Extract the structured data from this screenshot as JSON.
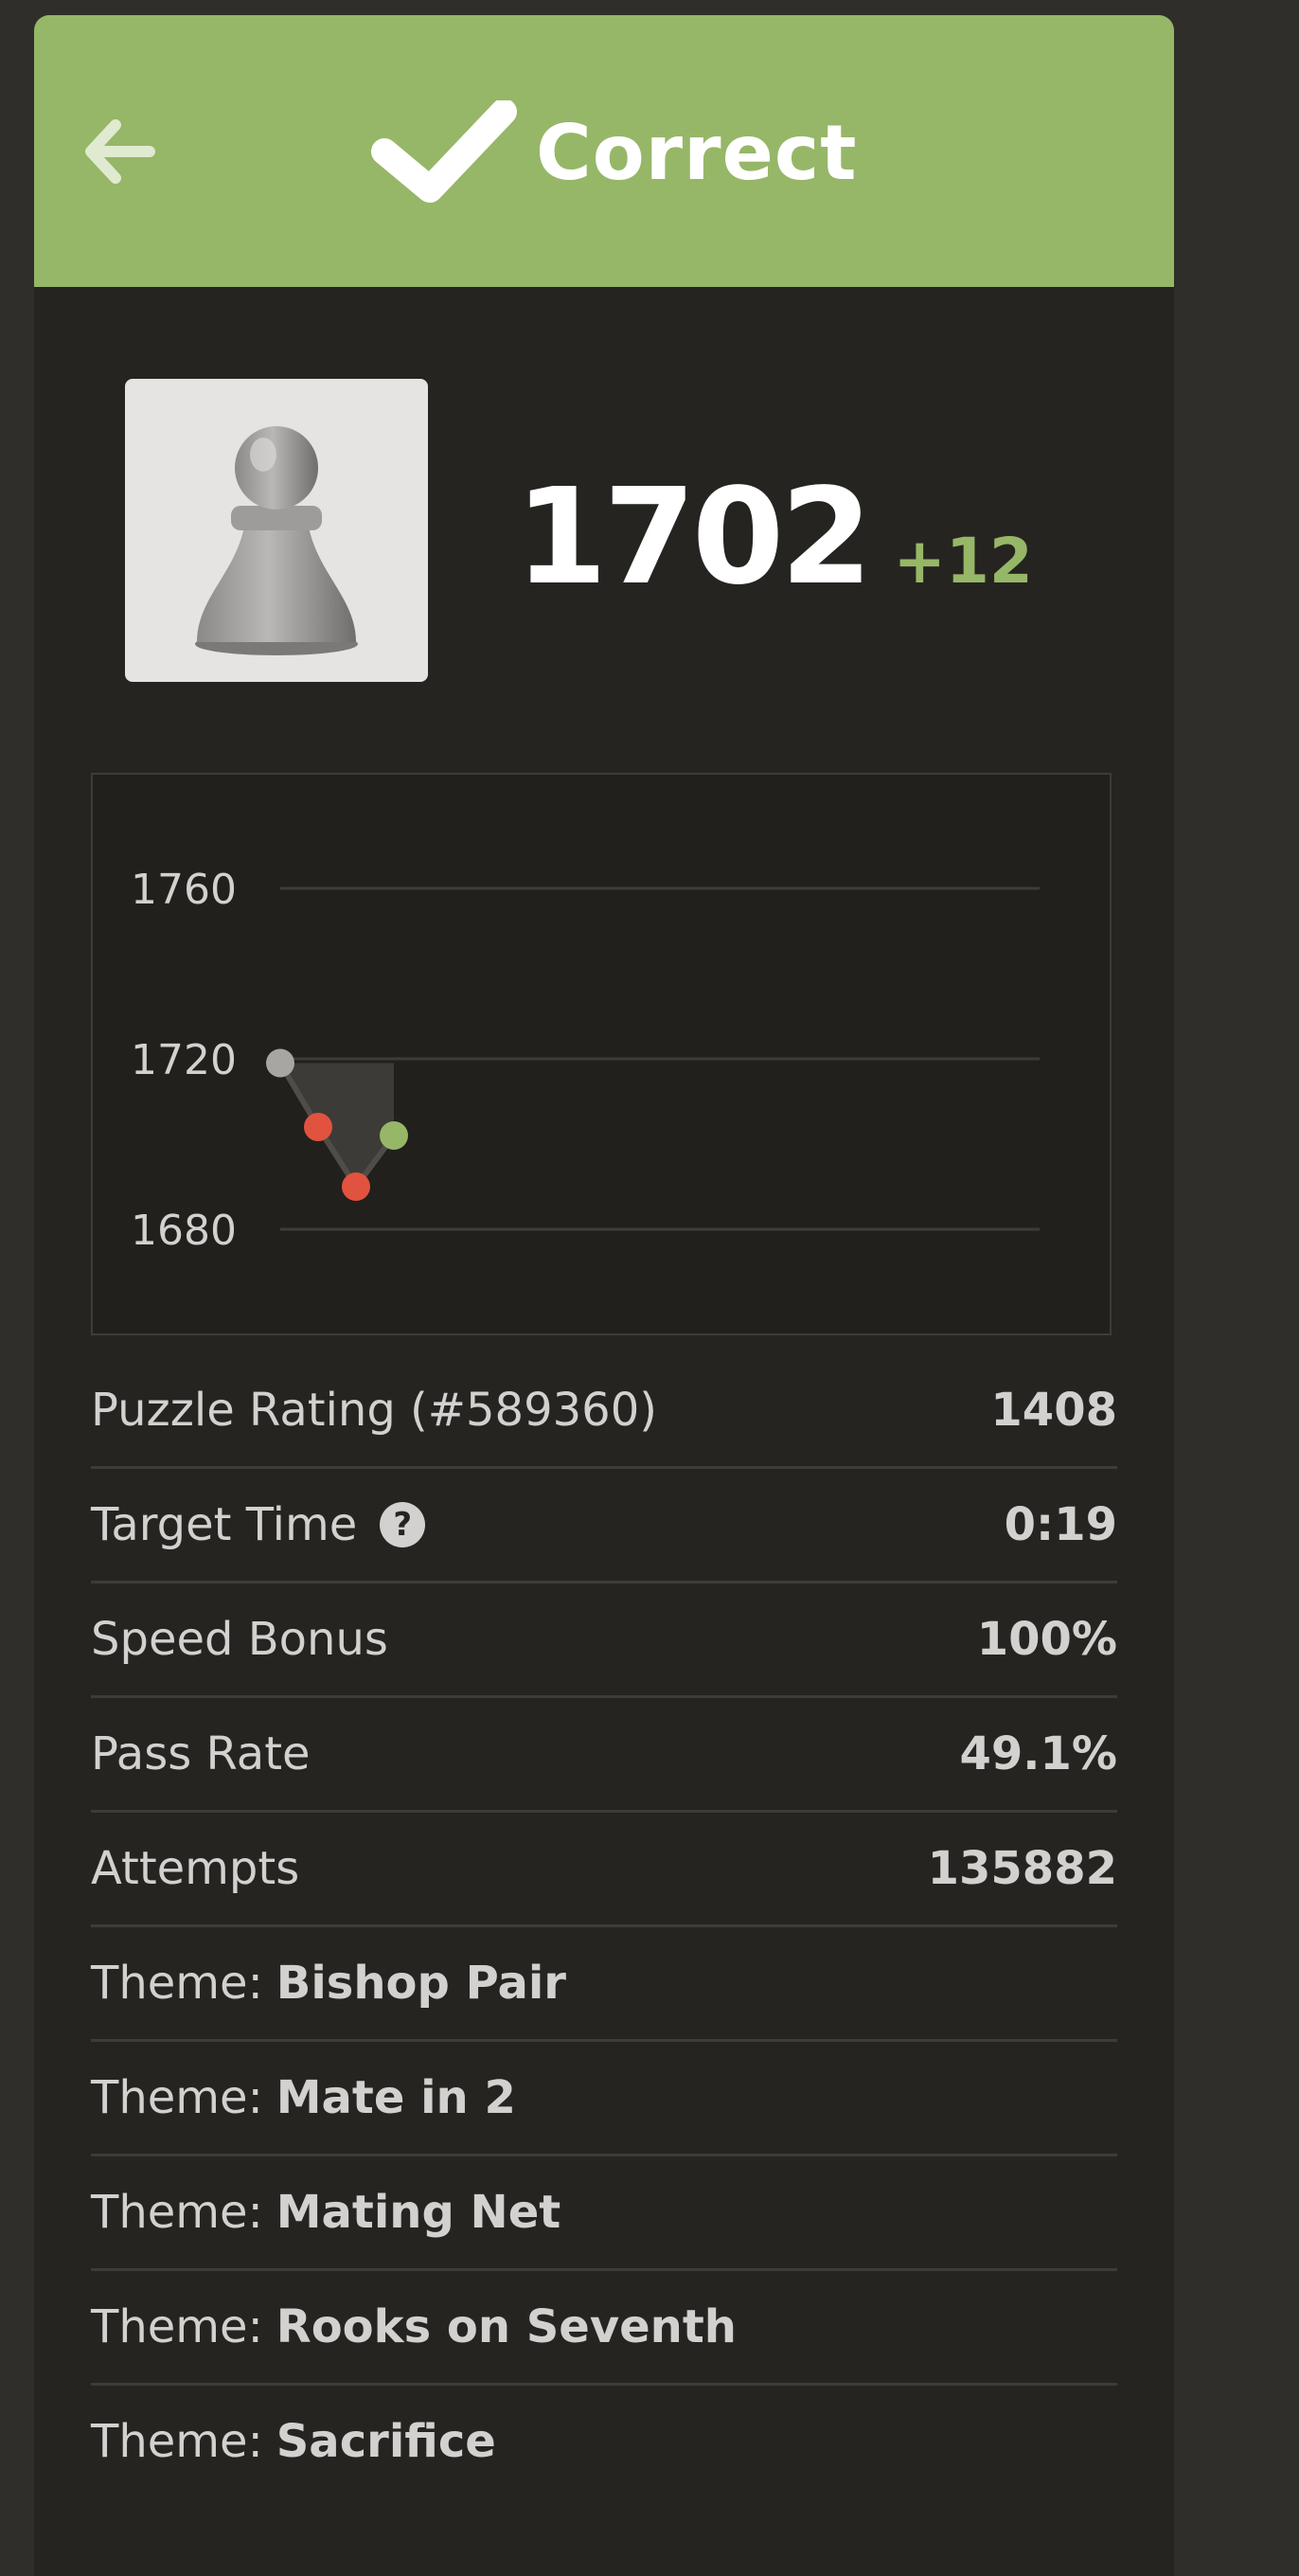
{
  "header": {
    "title": "Correct",
    "back_icon": "arrow-left-icon",
    "status_icon": "checkmark-icon",
    "color": "#96b767"
  },
  "player": {
    "avatar_icon": "pawn-icon",
    "rating": "1702",
    "rating_change": "+12"
  },
  "chart_data": {
    "type": "line",
    "yticks": [
      1760,
      1720,
      1680
    ],
    "ylim": [
      1680,
      1760
    ],
    "points": [
      {
        "x": 0,
        "y": 1719,
        "status": "start",
        "color": "#a7a6a2"
      },
      {
        "x": 1,
        "y": 1704,
        "status": "failed",
        "color": "#e1533e"
      },
      {
        "x": 2,
        "y": 1690,
        "status": "failed",
        "color": "#e1533e"
      },
      {
        "x": 3,
        "y": 1702,
        "status": "solved",
        "color": "#96b767"
      }
    ]
  },
  "stats": [
    {
      "label": "Puzzle Rating (#589360)",
      "value": "1408"
    },
    {
      "label": "Target Time",
      "value": "0:19",
      "help_icon": "question-circle-icon"
    },
    {
      "label": "Speed Bonus",
      "value": "100%"
    },
    {
      "label": "Pass Rate",
      "value": "49.1%"
    },
    {
      "label": "Attempts",
      "value": "135882"
    }
  ],
  "themes": {
    "prefix": "Theme:",
    "items": [
      "Bishop Pair",
      "Mate in 2",
      "Mating Net",
      "Rooks on Seventh",
      "Sacrifice"
    ]
  },
  "help_glyph": "?"
}
